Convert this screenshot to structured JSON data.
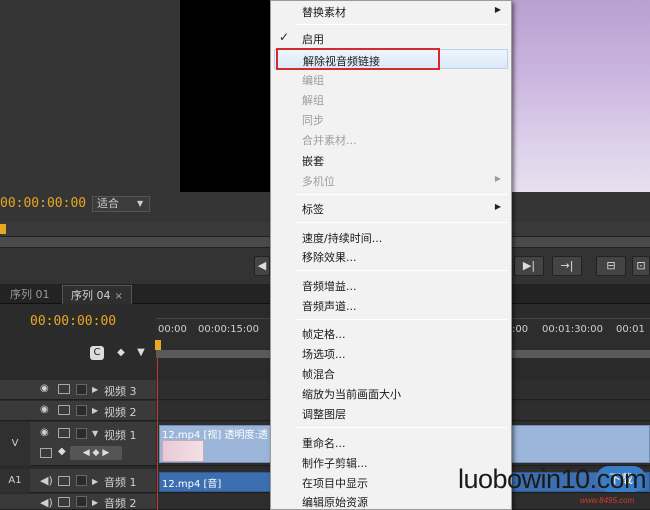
{
  "monitor": {
    "timecode": "00:00:00:00",
    "fit_label": "适合"
  },
  "sequence_tabs": [
    {
      "label": "序列 01"
    },
    {
      "label": "序列 04",
      "close": "×"
    }
  ],
  "timeline": {
    "timecode": "00:00:00:00",
    "ruler_ticks": [
      "00:00",
      "00:00:15:00",
      ":00",
      "00:01:30:00",
      "00:01"
    ],
    "tracks": {
      "v3": {
        "name": "视频 3"
      },
      "v2": {
        "name": "视频 2"
      },
      "v1": {
        "id": "V",
        "name": "视频 1"
      },
      "a1": {
        "id": "A1",
        "name": "音频 1"
      },
      "a2": {
        "name": "音频 2"
      }
    },
    "clips": {
      "v1_label": "12.mp4 [视] 透明度:透",
      "a1_label": "12.mp4 [音]"
    }
  },
  "context_menu": {
    "items": [
      {
        "label": "替换素材",
        "submenu": "▶"
      },
      {
        "label": "启用",
        "check": "✓"
      },
      {
        "label": "解除视音频链接"
      },
      {
        "label": "编组"
      },
      {
        "label": "解组"
      },
      {
        "label": "同步"
      },
      {
        "label": "合并素材..."
      },
      {
        "label": "嵌套"
      },
      {
        "label": "多机位",
        "submenu": "▶"
      },
      {
        "label": "标签",
        "submenu": "▶"
      },
      {
        "label": "速度/持续时间..."
      },
      {
        "label": "移除效果..."
      },
      {
        "label": "音频增益..."
      },
      {
        "label": "音频声道..."
      },
      {
        "label": "帧定格..."
      },
      {
        "label": "场选项..."
      },
      {
        "label": "帧混合"
      },
      {
        "label": "缩放为当前画面大小"
      },
      {
        "label": "调整图层"
      },
      {
        "label": "重命名..."
      },
      {
        "label": "制作子剪辑..."
      },
      {
        "label": "在项目中显示"
      },
      {
        "label": "编辑原始资源"
      }
    ]
  },
  "watermark": {
    "text": "luobowin10.com",
    "sub": "www.8495.com",
    "logo_text": "下载"
  },
  "colors": {
    "timecode": "#e8a820",
    "highlight_box": "#d42a2a"
  }
}
